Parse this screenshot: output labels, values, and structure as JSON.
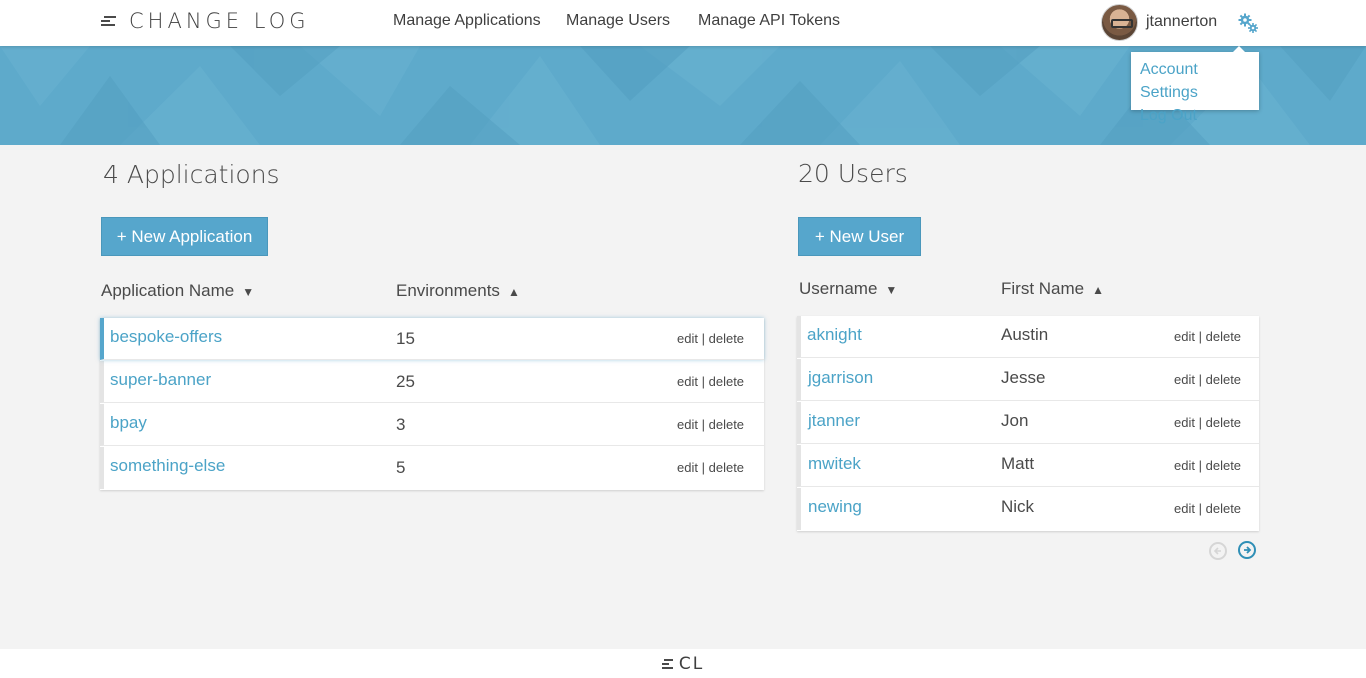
{
  "brand": {
    "title": "CHANGE LOG",
    "footer_logo": "CL",
    "icon": "menu-lines-icon"
  },
  "nav": {
    "links": [
      {
        "label": "Manage Applications"
      },
      {
        "label": "Manage Users"
      },
      {
        "label": "Manage API Tokens"
      }
    ],
    "username": "jtannerton",
    "settings_icon": "gears-icon"
  },
  "dropdown": {
    "items": [
      {
        "label": "Account Settings"
      },
      {
        "label": "Log Out"
      }
    ]
  },
  "colors": {
    "accent": "#56a6cc",
    "link": "#4ba3c7",
    "banner": "#5eaacb",
    "background": "#f3f3f3"
  },
  "applications": {
    "title": "4 Applications",
    "new_button": "+ New Application",
    "columns": [
      {
        "label": "Application Name",
        "sort": "▼"
      },
      {
        "label": "Environments",
        "sort": "▲"
      }
    ],
    "rows": [
      {
        "name": "bespoke-offers",
        "environments": "15",
        "selected": true
      },
      {
        "name": "super-banner",
        "environments": "25",
        "selected": false
      },
      {
        "name": "bpay",
        "environments": "3",
        "selected": false
      },
      {
        "name": "something-else",
        "environments": "5",
        "selected": false
      }
    ],
    "edit_label": "edit",
    "separator": "|",
    "delete_label": "delete"
  },
  "users": {
    "title": "20 Users",
    "new_button": "+ New User",
    "columns": [
      {
        "label": "Username",
        "sort": "▼"
      },
      {
        "label": "First Name",
        "sort": "▲"
      }
    ],
    "rows": [
      {
        "username": "aknight",
        "first_name": "Austin"
      },
      {
        "username": "jgarrison",
        "first_name": "Jesse"
      },
      {
        "username": "jtanner",
        "first_name": "Jon"
      },
      {
        "username": "mwitek",
        "first_name": "Matt"
      },
      {
        "username": "newing",
        "first_name": "Nick"
      }
    ],
    "edit_label": "edit",
    "separator": "|",
    "delete_label": "delete",
    "pager": {
      "prev_icon": "arrow-left-circle-icon",
      "next_icon": "arrow-right-circle-icon",
      "prev_disabled": true
    }
  }
}
